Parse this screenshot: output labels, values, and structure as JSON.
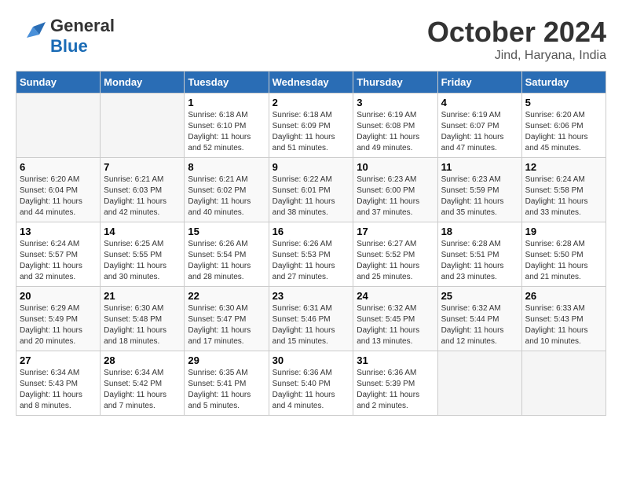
{
  "header": {
    "logo_general": "General",
    "logo_blue": "Blue",
    "month_title": "October 2024",
    "location": "Jind, Haryana, India"
  },
  "days_of_week": [
    "Sunday",
    "Monday",
    "Tuesday",
    "Wednesday",
    "Thursday",
    "Friday",
    "Saturday"
  ],
  "weeks": [
    [
      {
        "day": "",
        "info": ""
      },
      {
        "day": "",
        "info": ""
      },
      {
        "day": "1",
        "info": "Sunrise: 6:18 AM\nSunset: 6:10 PM\nDaylight: 11 hours and 52 minutes."
      },
      {
        "day": "2",
        "info": "Sunrise: 6:18 AM\nSunset: 6:09 PM\nDaylight: 11 hours and 51 minutes."
      },
      {
        "day": "3",
        "info": "Sunrise: 6:19 AM\nSunset: 6:08 PM\nDaylight: 11 hours and 49 minutes."
      },
      {
        "day": "4",
        "info": "Sunrise: 6:19 AM\nSunset: 6:07 PM\nDaylight: 11 hours and 47 minutes."
      },
      {
        "day": "5",
        "info": "Sunrise: 6:20 AM\nSunset: 6:06 PM\nDaylight: 11 hours and 45 minutes."
      }
    ],
    [
      {
        "day": "6",
        "info": "Sunrise: 6:20 AM\nSunset: 6:04 PM\nDaylight: 11 hours and 44 minutes."
      },
      {
        "day": "7",
        "info": "Sunrise: 6:21 AM\nSunset: 6:03 PM\nDaylight: 11 hours and 42 minutes."
      },
      {
        "day": "8",
        "info": "Sunrise: 6:21 AM\nSunset: 6:02 PM\nDaylight: 11 hours and 40 minutes."
      },
      {
        "day": "9",
        "info": "Sunrise: 6:22 AM\nSunset: 6:01 PM\nDaylight: 11 hours and 38 minutes."
      },
      {
        "day": "10",
        "info": "Sunrise: 6:23 AM\nSunset: 6:00 PM\nDaylight: 11 hours and 37 minutes."
      },
      {
        "day": "11",
        "info": "Sunrise: 6:23 AM\nSunset: 5:59 PM\nDaylight: 11 hours and 35 minutes."
      },
      {
        "day": "12",
        "info": "Sunrise: 6:24 AM\nSunset: 5:58 PM\nDaylight: 11 hours and 33 minutes."
      }
    ],
    [
      {
        "day": "13",
        "info": "Sunrise: 6:24 AM\nSunset: 5:57 PM\nDaylight: 11 hours and 32 minutes."
      },
      {
        "day": "14",
        "info": "Sunrise: 6:25 AM\nSunset: 5:55 PM\nDaylight: 11 hours and 30 minutes."
      },
      {
        "day": "15",
        "info": "Sunrise: 6:26 AM\nSunset: 5:54 PM\nDaylight: 11 hours and 28 minutes."
      },
      {
        "day": "16",
        "info": "Sunrise: 6:26 AM\nSunset: 5:53 PM\nDaylight: 11 hours and 27 minutes."
      },
      {
        "day": "17",
        "info": "Sunrise: 6:27 AM\nSunset: 5:52 PM\nDaylight: 11 hours and 25 minutes."
      },
      {
        "day": "18",
        "info": "Sunrise: 6:28 AM\nSunset: 5:51 PM\nDaylight: 11 hours and 23 minutes."
      },
      {
        "day": "19",
        "info": "Sunrise: 6:28 AM\nSunset: 5:50 PM\nDaylight: 11 hours and 21 minutes."
      }
    ],
    [
      {
        "day": "20",
        "info": "Sunrise: 6:29 AM\nSunset: 5:49 PM\nDaylight: 11 hours and 20 minutes."
      },
      {
        "day": "21",
        "info": "Sunrise: 6:30 AM\nSunset: 5:48 PM\nDaylight: 11 hours and 18 minutes."
      },
      {
        "day": "22",
        "info": "Sunrise: 6:30 AM\nSunset: 5:47 PM\nDaylight: 11 hours and 17 minutes."
      },
      {
        "day": "23",
        "info": "Sunrise: 6:31 AM\nSunset: 5:46 PM\nDaylight: 11 hours and 15 minutes."
      },
      {
        "day": "24",
        "info": "Sunrise: 6:32 AM\nSunset: 5:45 PM\nDaylight: 11 hours and 13 minutes."
      },
      {
        "day": "25",
        "info": "Sunrise: 6:32 AM\nSunset: 5:44 PM\nDaylight: 11 hours and 12 minutes."
      },
      {
        "day": "26",
        "info": "Sunrise: 6:33 AM\nSunset: 5:43 PM\nDaylight: 11 hours and 10 minutes."
      }
    ],
    [
      {
        "day": "27",
        "info": "Sunrise: 6:34 AM\nSunset: 5:43 PM\nDaylight: 11 hours and 8 minutes."
      },
      {
        "day": "28",
        "info": "Sunrise: 6:34 AM\nSunset: 5:42 PM\nDaylight: 11 hours and 7 minutes."
      },
      {
        "day": "29",
        "info": "Sunrise: 6:35 AM\nSunset: 5:41 PM\nDaylight: 11 hours and 5 minutes."
      },
      {
        "day": "30",
        "info": "Sunrise: 6:36 AM\nSunset: 5:40 PM\nDaylight: 11 hours and 4 minutes."
      },
      {
        "day": "31",
        "info": "Sunrise: 6:36 AM\nSunset: 5:39 PM\nDaylight: 11 hours and 2 minutes."
      },
      {
        "day": "",
        "info": ""
      },
      {
        "day": "",
        "info": ""
      }
    ]
  ]
}
